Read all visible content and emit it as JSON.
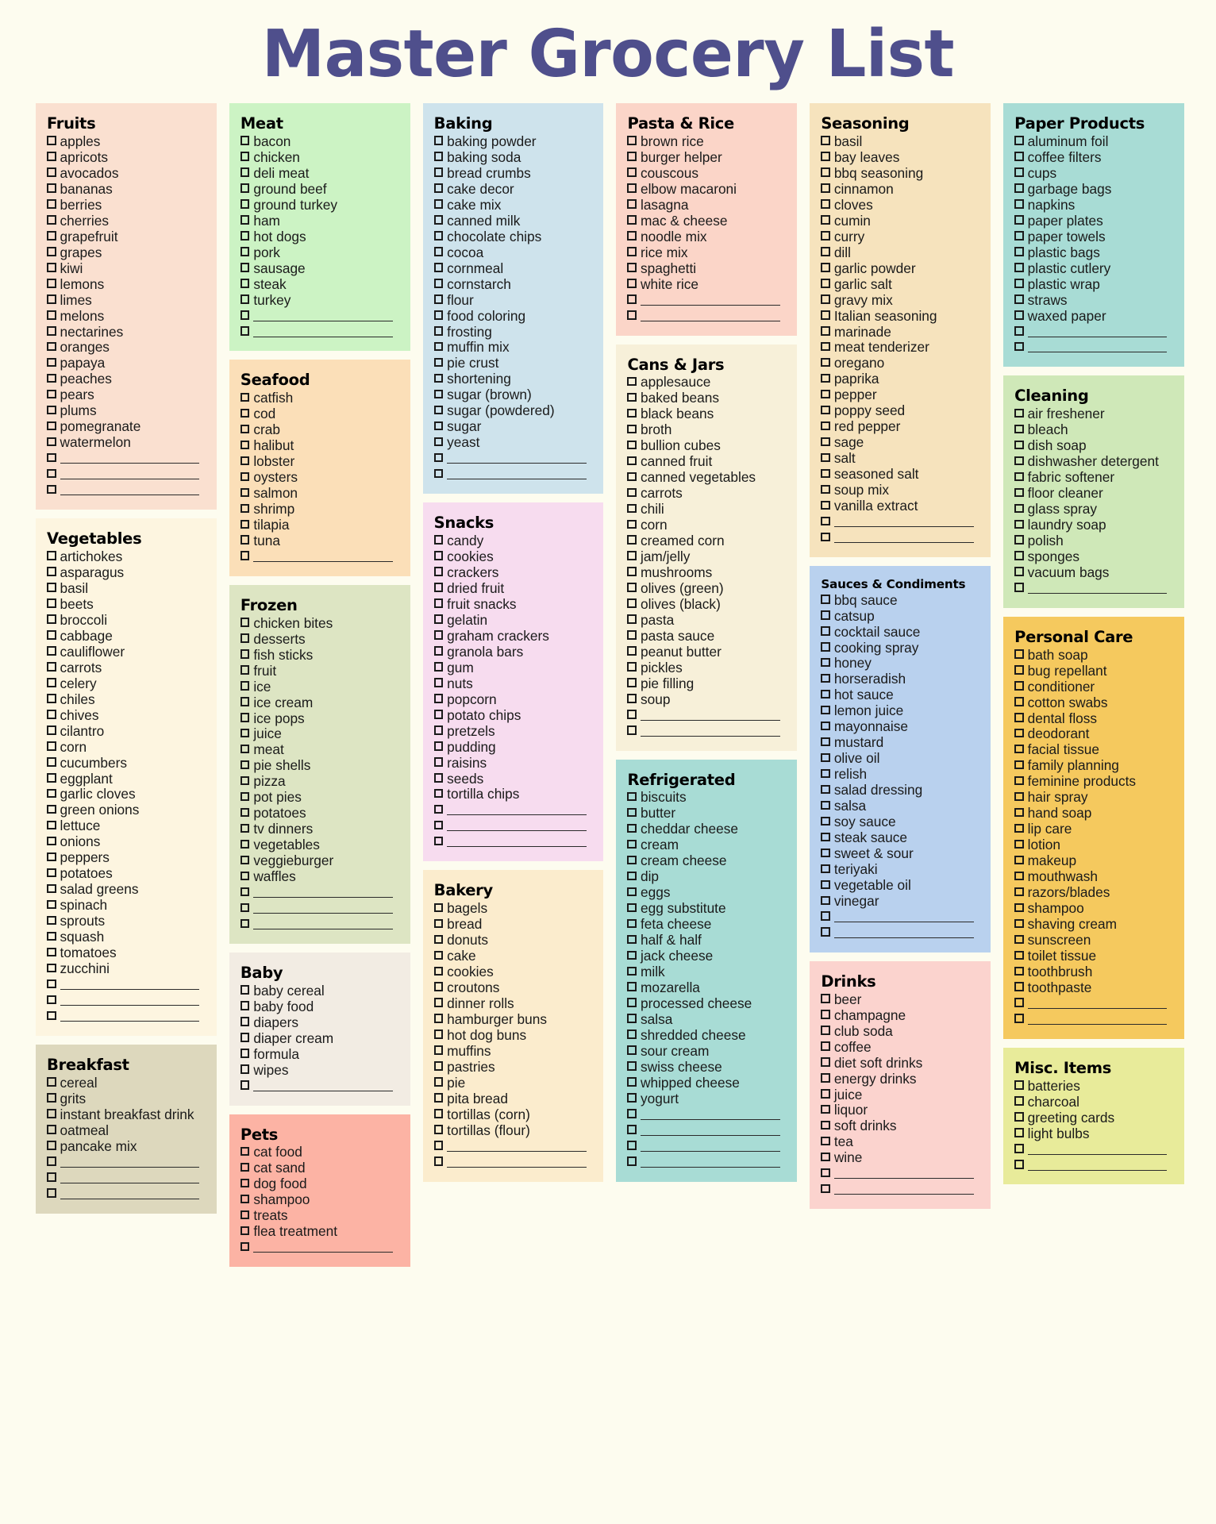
{
  "title": "Master Grocery List",
  "title_color": "#4f4f8c",
  "page_background": "#fdfcef",
  "columns": [
    {
      "id": "column-1",
      "sections": [
        {
          "name": "fruits",
          "heading": "Fruits",
          "color": "#fae0d0",
          "items": [
            "apples",
            "apricots",
            "avocados",
            "bananas",
            "berries",
            "cherries",
            "grapefruit",
            "grapes",
            "kiwi",
            "lemons",
            "limes",
            "melons",
            "nectarines",
            "oranges",
            "papaya",
            "peaches",
            "pears",
            "plums",
            "pomegranate",
            "watermelon"
          ],
          "blank_lines": 3
        },
        {
          "name": "vegetables",
          "heading": "Vegetables",
          "color": "#fdf5e0",
          "items": [
            "artichokes",
            "asparagus",
            "basil",
            "beets",
            "broccoli",
            "cabbage",
            "cauliflower",
            "carrots",
            "celery",
            "chiles",
            "chives",
            "cilantro",
            "corn",
            "cucumbers",
            "eggplant",
            "garlic cloves",
            "green onions",
            "lettuce",
            "onions",
            "peppers",
            "potatoes",
            "salad greens",
            "spinach",
            "sprouts",
            "squash",
            "tomatoes",
            "zucchini"
          ],
          "blank_lines": 3
        },
        {
          "name": "breakfast",
          "heading": "Breakfast",
          "color": "#ddd8bd",
          "items": [
            "cereal",
            "grits",
            "instant breakfast drink",
            "oatmeal",
            "pancake mix"
          ],
          "blank_lines": 3
        }
      ]
    },
    {
      "id": "column-2",
      "sections": [
        {
          "name": "meat",
          "heading": "Meat",
          "color": "#ccf3c4",
          "items": [
            "bacon",
            "chicken",
            "deli meat",
            "ground beef",
            "ground turkey",
            "ham",
            "hot dogs",
            "pork",
            "sausage",
            "steak",
            "turkey"
          ],
          "blank_lines": 2
        },
        {
          "name": "seafood",
          "heading": "Seafood",
          "color": "#fbdfb8",
          "items": [
            "catfish",
            "cod",
            "crab",
            "halibut",
            "lobster",
            "oysters",
            "salmon",
            "shrimp",
            "tilapia",
            "tuna"
          ],
          "blank_lines": 1
        },
        {
          "name": "frozen",
          "heading": "Frozen",
          "color": "#dde5c3",
          "items": [
            "chicken bites",
            "desserts",
            "fish sticks",
            "fruit",
            "ice",
            "ice cream",
            "ice pops",
            "juice",
            "meat",
            "pie shells",
            "pizza",
            "pot pies",
            "potatoes",
            "tv dinners",
            "vegetables",
            "veggieburger",
            "waffles"
          ],
          "blank_lines": 3
        },
        {
          "name": "baby",
          "heading": "Baby",
          "color": "#f2ece3",
          "items": [
            "baby cereal",
            "baby food",
            "diapers",
            "diaper cream",
            "formula",
            "wipes"
          ],
          "blank_lines": 1
        },
        {
          "name": "pets",
          "heading": "Pets",
          "color": "#fcb3a4",
          "items": [
            "cat food",
            "cat sand",
            "dog food",
            "shampoo",
            "treats",
            "flea treatment"
          ],
          "blank_lines": 1
        }
      ]
    },
    {
      "id": "column-3",
      "sections": [
        {
          "name": "baking",
          "heading": "Baking",
          "color": "#cee3ec",
          "items": [
            "baking powder",
            "baking soda",
            "bread crumbs",
            "cake decor",
            "cake mix",
            "canned milk",
            "chocolate chips",
            "cocoa",
            "cornmeal",
            "cornstarch",
            "flour",
            "food coloring",
            "frosting",
            "muffin mix",
            "pie crust",
            "shortening",
            "sugar (brown)",
            "sugar (powdered)",
            "sugar",
            "yeast"
          ],
          "blank_lines": 2
        },
        {
          "name": "snacks",
          "heading": "Snacks",
          "color": "#f7dcef",
          "items": [
            "candy",
            "cookies",
            "crackers",
            "dried fruit",
            "fruit snacks",
            "gelatin",
            "graham crackers",
            "granola bars",
            "gum",
            "nuts",
            "popcorn",
            "potato chips",
            "pretzels",
            "pudding",
            "raisins",
            "seeds",
            "tortilla chips"
          ],
          "blank_lines": 3
        },
        {
          "name": "bakery",
          "heading": "Bakery",
          "color": "#fbeccd",
          "items": [
            "bagels",
            "bread",
            "donuts",
            "cake",
            "cookies",
            "croutons",
            "dinner rolls",
            "hamburger buns",
            "hot dog buns",
            "muffins",
            "pastries",
            "pie",
            "pita bread",
            "tortillas (corn)",
            "tortillas (flour)"
          ],
          "blank_lines": 2
        }
      ]
    },
    {
      "id": "column-4",
      "sections": [
        {
          "name": "pasta-and-rice",
          "heading": "Pasta & Rice",
          "color": "#fbd5c8",
          "items": [
            "brown rice",
            "burger helper",
            "couscous",
            "elbow macaroni",
            "lasagna",
            "mac & cheese",
            "noodle mix",
            "rice mix",
            "spaghetti",
            "white rice"
          ],
          "blank_lines": 2
        },
        {
          "name": "cans-and-jars",
          "heading": "Cans & Jars",
          "color": "#f7f0d9",
          "items": [
            "applesauce",
            "baked beans",
            "black beans",
            "broth",
            "bullion cubes",
            "canned fruit",
            "canned vegetables",
            "carrots",
            "chili",
            "corn",
            "creamed corn",
            "jam/jelly",
            "mushrooms",
            "olives (green)",
            "olives (black)",
            "pasta",
            "pasta sauce",
            "peanut butter",
            "pickles",
            "pie filling",
            "soup"
          ],
          "blank_lines": 2
        },
        {
          "name": "refrigerated",
          "heading": "Refrigerated",
          "color": "#a8dcd5",
          "items": [
            "biscuits",
            "butter",
            "cheddar cheese",
            "cream",
            "cream cheese",
            "dip",
            "eggs",
            "egg substitute",
            "feta cheese",
            "half & half",
            "jack cheese",
            "milk",
            "mozarella",
            "processed cheese",
            "salsa",
            "shredded cheese",
            "sour cream",
            "swiss cheese",
            "whipped cheese",
            "yogurt"
          ],
          "blank_lines": 4
        }
      ]
    },
    {
      "id": "column-5",
      "sections": [
        {
          "name": "seasoning",
          "heading": "Seasoning",
          "color": "#f6e3bd",
          "items": [
            "basil",
            "bay leaves",
            "bbq seasoning",
            "cinnamon",
            "cloves",
            "cumin",
            "curry",
            "dill",
            "garlic powder",
            "garlic salt",
            "gravy mix",
            "Italian seasoning",
            "marinade",
            "meat tenderizer",
            "oregano",
            "paprika",
            "pepper",
            "poppy seed",
            "red pepper",
            "sage",
            "salt",
            "seasoned salt",
            "soup mix",
            "vanilla extract"
          ],
          "blank_lines": 2
        },
        {
          "name": "sauces-and-condiments",
          "heading": "Sauces & Condiments",
          "heading_size": "small",
          "color": "#b9d1ee",
          "items": [
            "bbq sauce",
            "catsup",
            "cocktail sauce",
            "cooking spray",
            "honey",
            "horseradish",
            "hot sauce",
            "lemon juice",
            "mayonnaise",
            "mustard",
            "olive oil",
            "relish",
            "salad dressing",
            "salsa",
            "soy sauce",
            "steak sauce",
            "sweet & sour",
            "teriyaki",
            "vegetable oil",
            "vinegar"
          ],
          "blank_lines": 2
        },
        {
          "name": "drinks",
          "heading": "Drinks",
          "color": "#fbd3ce",
          "items": [
            "beer",
            "champagne",
            "club soda",
            "coffee",
            "diet soft drinks",
            "energy drinks",
            "juice",
            "liquor",
            "soft drinks",
            "tea",
            "wine"
          ],
          "blank_lines": 2
        }
      ]
    },
    {
      "id": "column-6",
      "sections": [
        {
          "name": "paper-products",
          "heading": "Paper Products",
          "color": "#a8dcd5",
          "items": [
            "aluminum foil",
            "coffee filters",
            "cups",
            "garbage bags",
            "napkins",
            "paper plates",
            "paper towels",
            "plastic bags",
            "plastic cutlery",
            "plastic wrap",
            "straws",
            "waxed paper"
          ],
          "blank_lines": 2
        },
        {
          "name": "cleaning",
          "heading": "Cleaning",
          "color": "#cfe8b8",
          "items": [
            "air freshener",
            "bleach",
            "dish soap",
            "dishwasher detergent",
            "fabric softener",
            "floor cleaner",
            "glass spray",
            "laundry soap",
            "polish",
            "sponges",
            "vacuum bags"
          ],
          "blank_lines": 1
        },
        {
          "name": "personal-care",
          "heading": "Personal Care",
          "color": "#f5c95e",
          "items": [
            "bath soap",
            "bug repellant",
            "conditioner",
            "cotton swabs",
            "dental floss",
            "deodorant",
            "facial tissue",
            "family planning",
            "feminine products",
            "hair spray",
            "hand soap",
            "lip care",
            "lotion",
            "makeup",
            "mouthwash",
            "razors/blades",
            "shampoo",
            "shaving cream",
            "sunscreen",
            "toilet tissue",
            "toothbrush",
            "toothpaste"
          ],
          "blank_lines": 2
        },
        {
          "name": "misc-items",
          "heading": "Misc. Items",
          "color": "#e8eb9a",
          "items": [
            "batteries",
            "charcoal",
            "greeting cards",
            "light bulbs"
          ],
          "blank_lines": 2
        }
      ]
    }
  ]
}
